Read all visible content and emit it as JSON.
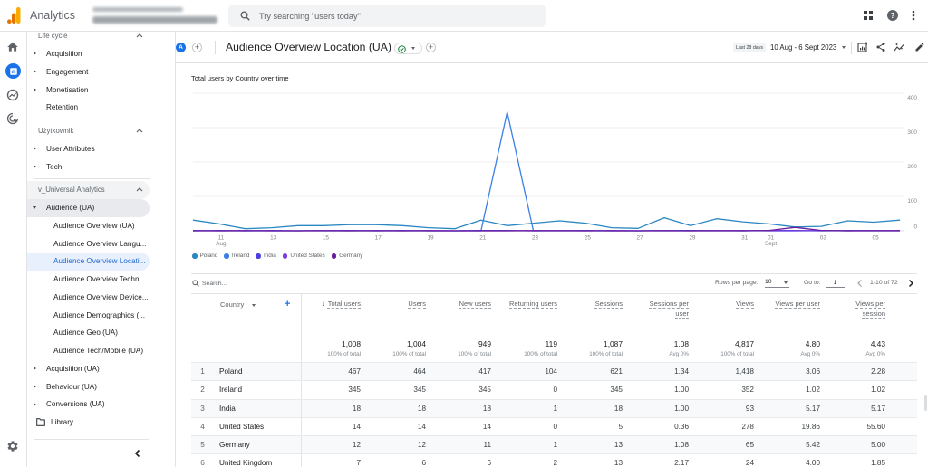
{
  "app": {
    "name": "Analytics",
    "logo_icon": "analytics-logo"
  },
  "search": {
    "placeholder": "Try searching \"users today\"",
    "icon": "search-icon"
  },
  "topbar": {
    "icons": [
      "apps-icon",
      "help-icon",
      "more-vert-icon"
    ]
  },
  "rail": {
    "icons": [
      "home-icon",
      "reports-icon",
      "explore-icon",
      "advertising-icon"
    ],
    "active_index": 1,
    "settings_icon": "gear-icon"
  },
  "sidebar": {
    "lifecycle": {
      "title": "Life cycle",
      "items": [
        "Acquisition",
        "Engagement",
        "Monetisation",
        "Retention"
      ]
    },
    "user": {
      "title": "Użytkownik",
      "items": [
        "User Attributes",
        "Tech"
      ]
    },
    "ua": {
      "title": "v_Universal Analytics",
      "audience": {
        "label": "Audience (UA)",
        "expanded": true,
        "children": [
          "Audience Overview (UA)",
          "Audience Overview Langu...",
          "Audience Overview Locati...",
          "Audience Overview Techn...",
          "Audience Overview Device...",
          "Audience Demographics (...",
          "Audience Geo (UA)",
          "Audience Tech/Mobile (UA)"
        ],
        "selected_index": 2
      },
      "items": [
        "Acquisition (UA)",
        "Behaviour (UA)",
        "Conversions (UA)"
      ]
    },
    "library": "Library"
  },
  "report": {
    "avatar": "A",
    "title": "Audience Overview Location (UA)",
    "status_icon": "check-circle-icon",
    "date_preset": "Last 28 days",
    "date_range": "10 Aug - 6 Sept 2023",
    "actions": [
      "customize-report-icon",
      "share-icon",
      "insights-icon",
      "edit-icon"
    ]
  },
  "chart_data": {
    "type": "line",
    "title": "Total users by Country over time",
    "xlabel": "",
    "ylabel": "",
    "x": [
      "10 Aug",
      "11 Aug",
      "12 Aug",
      "13 Aug",
      "14 Aug",
      "15 Aug",
      "16 Aug",
      "17 Aug",
      "18 Aug",
      "19 Aug",
      "20 Aug",
      "21 Aug",
      "22 Aug",
      "23 Aug",
      "24 Aug",
      "25 Aug",
      "26 Aug",
      "27 Aug",
      "28 Aug",
      "29 Aug",
      "30 Aug",
      "31 Aug",
      "01 Sept",
      "02 Sept",
      "03 Sept",
      "04 Sept",
      "05 Sept",
      "06 Sept"
    ],
    "xticks": [
      {
        "index": 1,
        "label": "11",
        "sublabel": "Aug"
      },
      {
        "index": 3,
        "label": "13"
      },
      {
        "index": 5,
        "label": "15"
      },
      {
        "index": 7,
        "label": "17"
      },
      {
        "index": 9,
        "label": "19"
      },
      {
        "index": 11,
        "label": "21"
      },
      {
        "index": 13,
        "label": "23"
      },
      {
        "index": 15,
        "label": "25"
      },
      {
        "index": 17,
        "label": "27"
      },
      {
        "index": 19,
        "label": "29"
      },
      {
        "index": 21,
        "label": "31"
      },
      {
        "index": 22,
        "label": "01",
        "sublabel": "Sept"
      },
      {
        "index": 24,
        "label": "03"
      },
      {
        "index": 26,
        "label": "05"
      }
    ],
    "ylim": [
      0,
      400
    ],
    "yticks": [
      0,
      100,
      200,
      300,
      400
    ],
    "ytick_labels": [
      "0",
      "100",
      "200",
      "300",
      "400"
    ],
    "yaxis_side": "right",
    "grid": true,
    "legend": "bottom-left",
    "series": [
      {
        "name": "Poland",
        "color": "#2a87c2",
        "values": [
          31,
          20,
          6,
          9,
          15,
          15,
          18,
          18,
          15,
          9,
          6,
          31,
          15,
          22,
          29,
          22,
          9,
          7,
          38,
          15,
          35,
          26,
          20,
          11,
          13,
          29,
          25,
          31
        ]
      },
      {
        "name": "Ireland",
        "color": "#3b7fe6",
        "values": [
          0,
          0,
          0,
          0,
          0,
          0,
          0,
          0,
          0,
          0,
          0,
          0,
          345,
          0,
          0,
          0,
          0,
          0,
          0,
          0,
          0,
          0,
          0,
          0,
          0,
          0,
          0,
          0
        ]
      },
      {
        "name": "India",
        "color": "#4b3fe0",
        "values": [
          0,
          1,
          0,
          1,
          0,
          1,
          1,
          0,
          1,
          0,
          0,
          1,
          1,
          0,
          1,
          1,
          0,
          0,
          1,
          1,
          1,
          0,
          1,
          1,
          0,
          1,
          1,
          1
        ]
      },
      {
        "name": "United States",
        "color": "#7b3fe0",
        "values": [
          1,
          0,
          1,
          0,
          0,
          1,
          0,
          1,
          0,
          1,
          0,
          0,
          0,
          1,
          1,
          0,
          1,
          0,
          1,
          0,
          1,
          1,
          0,
          0,
          1,
          0,
          1,
          1
        ]
      },
      {
        "name": "Germany",
        "color": "#6a1b9a",
        "values": [
          0,
          0,
          0,
          0,
          0,
          0,
          0,
          0,
          0,
          0,
          0,
          0,
          0,
          0,
          0,
          0,
          0,
          0,
          0,
          0,
          0,
          0,
          1,
          10,
          1,
          0,
          0,
          0
        ]
      }
    ]
  },
  "table": {
    "search_placeholder": "Search...",
    "rows_per_page_label": "Rows per page:",
    "rows_per_page": "10",
    "goto_label": "Go to:",
    "goto_value": "1",
    "range": "1-10 of 72",
    "dimension_header": "Country",
    "columns": [
      {
        "label": "Total users",
        "sort": "desc"
      },
      {
        "label": "Users"
      },
      {
        "label": "New users"
      },
      {
        "label": "Returning users"
      },
      {
        "label": "Sessions"
      },
      {
        "label": "Sessions per user"
      },
      {
        "label": "Views"
      },
      {
        "label": "Views per user"
      },
      {
        "label": "Views per session"
      }
    ],
    "totals": [
      {
        "value": "1,008",
        "sub": "100% of total"
      },
      {
        "value": "1,004",
        "sub": "100% of total"
      },
      {
        "value": "949",
        "sub": "100% of total"
      },
      {
        "value": "119",
        "sub": "100% of total"
      },
      {
        "value": "1,087",
        "sub": "100% of total"
      },
      {
        "value": "1.08",
        "sub": "Avg 0%"
      },
      {
        "value": "4,817",
        "sub": "100% of total"
      },
      {
        "value": "4.80",
        "sub": "Avg 0%"
      },
      {
        "value": "4.43",
        "sub": "Avg 0%"
      }
    ],
    "rows": [
      {
        "rank": "1",
        "country": "Poland",
        "values": [
          "467",
          "464",
          "417",
          "104",
          "621",
          "1.34",
          "1,418",
          "3.06",
          "2.28"
        ]
      },
      {
        "rank": "2",
        "country": "Ireland",
        "values": [
          "345",
          "345",
          "345",
          "0",
          "345",
          "1.00",
          "352",
          "1.02",
          "1.02"
        ]
      },
      {
        "rank": "3",
        "country": "India",
        "values": [
          "18",
          "18",
          "18",
          "1",
          "18",
          "1.00",
          "93",
          "5.17",
          "5.17"
        ]
      },
      {
        "rank": "4",
        "country": "United States",
        "values": [
          "14",
          "14",
          "14",
          "0",
          "5",
          "0.36",
          "278",
          "19.86",
          "55.60"
        ]
      },
      {
        "rank": "5",
        "country": "Germany",
        "values": [
          "12",
          "12",
          "11",
          "1",
          "13",
          "1.08",
          "65",
          "5.42",
          "5.00"
        ]
      },
      {
        "rank": "6",
        "country": "United Kingdom",
        "values": [
          "7",
          "6",
          "6",
          "2",
          "13",
          "2.17",
          "24",
          "4.00",
          "1.85"
        ]
      }
    ]
  },
  "colors": {
    "accent": "#1a73e8",
    "selected_bg": "#e8f0fe",
    "selected_text": "#1967d2",
    "status_ok": "#188038"
  }
}
